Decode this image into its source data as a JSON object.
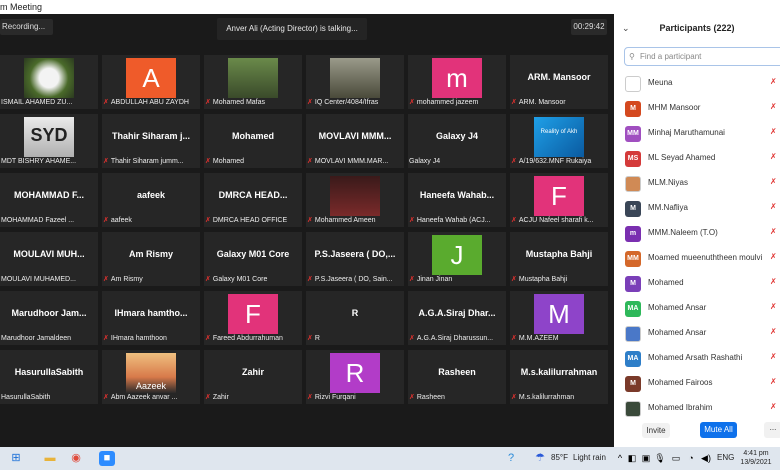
{
  "window": {
    "title": "m Meeting"
  },
  "meeting": {
    "recording_label": "Recording...",
    "talking_banner": "Anver Ali (Acting Director) is talking...",
    "timer": "00:29:42"
  },
  "tiles": [
    {
      "name": "",
      "label": "ISMAIL AHAMED ZU...",
      "muted": false,
      "avatar_letter": "",
      "avatar_color": "",
      "photo": "flower"
    },
    {
      "name": "",
      "label": "ABDULLAH ABU ZAYDH",
      "muted": true,
      "avatar_letter": "A",
      "avatar_color": "#ef5b2a",
      "photo": ""
    },
    {
      "name": "",
      "label": "Mohamed Mafas",
      "muted": true,
      "avatar_letter": "",
      "avatar_color": "",
      "photo": "outdoor"
    },
    {
      "name": "",
      "label": "IQ Center/4084/Ifras",
      "muted": true,
      "avatar_letter": "",
      "avatar_color": "",
      "photo": "person"
    },
    {
      "name": "",
      "label": "mohammed jazeem",
      "muted": true,
      "avatar_letter": "m",
      "avatar_color": "#e2337a",
      "photo": ""
    },
    {
      "name": "ARM. Mansoor",
      "label": "ARM. Mansoor",
      "muted": true,
      "avatar_letter": "",
      "avatar_color": "",
      "photo": ""
    },
    {
      "name": "",
      "label": "MDT BISHRY AHAME...",
      "muted": false,
      "avatar_letter": "",
      "avatar_color": "",
      "photo": "text"
    },
    {
      "name": "Thahir Siharam j...",
      "label": "Thahir Siharam jumm...",
      "muted": true,
      "avatar_letter": "",
      "avatar_color": "",
      "photo": ""
    },
    {
      "name": "Mohamed",
      "label": "Mohamed",
      "muted": true,
      "avatar_letter": "",
      "avatar_color": "",
      "photo": ""
    },
    {
      "name": "MOVLAVI MMM...",
      "label": "MOVLAVI MMM.MAR...",
      "muted": true,
      "avatar_letter": "",
      "avatar_color": "",
      "photo": ""
    },
    {
      "name": "Galaxy J4",
      "label": "Galaxy J4",
      "muted": false,
      "avatar_letter": "",
      "avatar_color": "",
      "photo": ""
    },
    {
      "name": "",
      "label": "A/19/632.MNF Rukaiya",
      "muted": true,
      "avatar_letter": "",
      "avatar_color": "",
      "photo": "blue"
    },
    {
      "name": "MOHAMMAD F...",
      "label": "MOHAMMAD Fazeel ...",
      "muted": false,
      "avatar_letter": "",
      "avatar_color": "",
      "photo": ""
    },
    {
      "name": "aafeek",
      "label": "aafeek",
      "muted": true,
      "avatar_letter": "",
      "avatar_color": "",
      "photo": ""
    },
    {
      "name": "DMRCA HEAD...",
      "label": "DMRCA HEAD OFFICE",
      "muted": true,
      "avatar_letter": "",
      "avatar_color": "",
      "photo": ""
    },
    {
      "name": "",
      "label": "Mohammed Ameen",
      "muted": true,
      "avatar_letter": "",
      "avatar_color": "",
      "photo": "dark"
    },
    {
      "name": "Haneefa Wahab...",
      "label": "Haneefa Wahab (ACJ...",
      "muted": true,
      "avatar_letter": "",
      "avatar_color": "",
      "photo": ""
    },
    {
      "name": "",
      "label": "ACJU Nafeel sharafi k...",
      "muted": true,
      "avatar_letter": "F",
      "avatar_color": "#e2337a",
      "photo": ""
    },
    {
      "name": "MOULAVI MUH...",
      "label": "MOULAVI MUHAMED...",
      "muted": false,
      "avatar_letter": "",
      "avatar_color": "",
      "photo": ""
    },
    {
      "name": "Am Rismy",
      "label": "Am Rismy",
      "muted": true,
      "avatar_letter": "",
      "avatar_color": "",
      "photo": ""
    },
    {
      "name": "Galaxy M01 Core",
      "label": "Galaxy M01 Core",
      "muted": true,
      "avatar_letter": "",
      "avatar_color": "",
      "photo": ""
    },
    {
      "name": "P.S.Jaseera ( DO,...",
      "label": "P.S.Jaseera ( DO, Sain...",
      "muted": true,
      "avatar_letter": "",
      "avatar_color": "",
      "photo": ""
    },
    {
      "name": "",
      "label": "Jinan Jinan",
      "muted": true,
      "avatar_letter": "J",
      "avatar_color": "#5aab2e",
      "photo": ""
    },
    {
      "name": "Mustapha Bahji",
      "label": "Mustapha Bahji",
      "muted": true,
      "avatar_letter": "",
      "avatar_color": "",
      "photo": ""
    },
    {
      "name": "Marudhoor Jam...",
      "label": "Marudhoor Jamaldeen",
      "muted": false,
      "avatar_letter": "",
      "avatar_color": "",
      "photo": ""
    },
    {
      "name": "IHmara hamtho...",
      "label": "IHmara hamthoon",
      "muted": true,
      "avatar_letter": "",
      "avatar_color": "",
      "photo": ""
    },
    {
      "name": "",
      "label": "Fareed Abdurrahuman",
      "muted": true,
      "avatar_letter": "F",
      "avatar_color": "#e2337a",
      "photo": ""
    },
    {
      "name": "R",
      "label": "R",
      "muted": true,
      "avatar_letter": "",
      "avatar_color": "",
      "photo": ""
    },
    {
      "name": "A.G.A.Siraj Dhar...",
      "label": "A.G.A.Siraj Dharussun...",
      "muted": true,
      "avatar_letter": "",
      "avatar_color": "",
      "photo": ""
    },
    {
      "name": "",
      "label": "M.M.AZEEM",
      "muted": true,
      "avatar_letter": "M",
      "avatar_color": "#8e44c9",
      "photo": ""
    },
    {
      "name": "HasurullaSabith",
      "label": "HasurullaSabith",
      "muted": false,
      "avatar_letter": "",
      "avatar_color": "",
      "photo": ""
    },
    {
      "name": "",
      "label": "Abm Aazeek anvar ...",
      "muted": true,
      "avatar_letter": "",
      "avatar_color": "",
      "photo": "sunset"
    },
    {
      "name": "Zahir",
      "label": "Zahir",
      "muted": true,
      "avatar_letter": "",
      "avatar_color": "",
      "photo": ""
    },
    {
      "name": "",
      "label": "Rizvi Furqani",
      "muted": true,
      "avatar_letter": "R",
      "avatar_color": "#b23cc8",
      "photo": ""
    },
    {
      "name": "Rasheen",
      "label": "Rasheen",
      "muted": true,
      "avatar_letter": "",
      "avatar_color": "",
      "photo": ""
    },
    {
      "name": "M.s.kalilurrahman",
      "label": "M.s.kalilurrahman",
      "muted": true,
      "avatar_letter": "",
      "avatar_color": "",
      "photo": ""
    }
  ],
  "tile_overlay_text": {
    "photo_text": "Aazeek",
    "photo_blue_text": "Reality of Akh",
    "photo_mdt_text": "SYD"
  },
  "participants": {
    "title": "Participants (222)",
    "search_placeholder": "Find a participant",
    "list": [
      {
        "name": "Meuna",
        "initials": "",
        "color": "#ffffff"
      },
      {
        "name": "MHM Mansoor",
        "initials": "M",
        "color": "#d4491f"
      },
      {
        "name": "Minhaj Maruthamunai",
        "initials": "MM",
        "color": "#a04fc0"
      },
      {
        "name": "ML Seyad Ahamed",
        "initials": "MS",
        "color": "#d43a3a"
      },
      {
        "name": "MLM.Niyas",
        "initials": "",
        "color": "#d08a55"
      },
      {
        "name": "MM.Nafliya",
        "initials": "M",
        "color": "#3a4657"
      },
      {
        "name": "MMM.Naleem (T.O)",
        "initials": "m",
        "color": "#7a2fb0"
      },
      {
        "name": "Moamed mueenuththeen moulvi",
        "initials": "MM",
        "color": "#d4682a"
      },
      {
        "name": "Mohamed",
        "initials": "M",
        "color": "#7a3fb8"
      },
      {
        "name": "Mohamed Ansar",
        "initials": "MA",
        "color": "#2eb85a"
      },
      {
        "name": "Mohamed Ansar",
        "initials": "",
        "color": "#4a78c8"
      },
      {
        "name": "Mohamed Arsath Rashathi",
        "initials": "MA",
        "color": "#2e7ec8"
      },
      {
        "name": "Mohamed Fairoos",
        "initials": "M",
        "color": "#7a3a2a"
      },
      {
        "name": "Mohamed Ibrahim",
        "initials": "",
        "color": "#3a4a3a"
      }
    ],
    "invite_label": "Invite",
    "mute_all_label": "Mute All",
    "more_label": "..."
  },
  "taskbar": {
    "weather_temp": "85°F",
    "weather_text": "Light rain",
    "lang": "ENG",
    "time": "4:41 pm",
    "date": "13/9/2021"
  }
}
